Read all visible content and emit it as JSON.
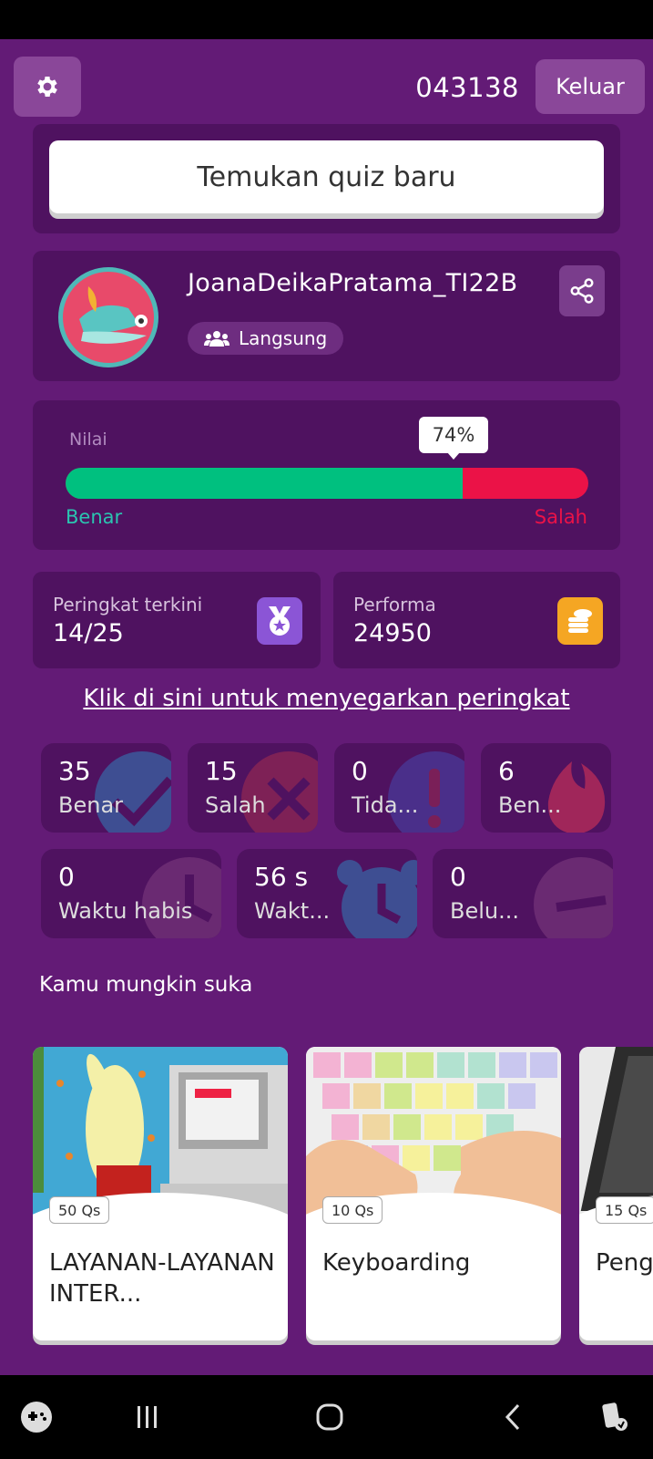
{
  "header": {
    "room_code": "043138",
    "exit_label": "Keluar"
  },
  "find_quiz": {
    "label": "Temukan quiz baru"
  },
  "profile": {
    "username": "JoanaDeikaPratama_TI22B",
    "mode": "Langsung"
  },
  "score": {
    "label": "Nilai",
    "percent_text": "74%",
    "percent": 0.76,
    "correct_label": "Benar",
    "wrong_label": "Salah"
  },
  "rank": {
    "label": "Peringkat terkini",
    "value": "14/25"
  },
  "performance": {
    "label": "Performa",
    "value": "24950"
  },
  "refresh_link": "Klik di sini untuk menyegarkan peringkat",
  "stats": [
    {
      "value": "35",
      "label": "Benar"
    },
    {
      "value": "15",
      "label": "Salah"
    },
    {
      "value": "0",
      "label": "Tida..."
    },
    {
      "value": "6",
      "label": "Ben..."
    },
    {
      "value": "0",
      "label": "Waktu habis"
    },
    {
      "value": "56 s",
      "label": "Wakt..."
    },
    {
      "value": "0",
      "label": "Belu..."
    }
  ],
  "recommendations": {
    "title": "Kamu mungkin suka",
    "items": [
      {
        "qs": "50 Qs",
        "title": "LAYANAN-LAYANAN INTER..."
      },
      {
        "qs": "10 Qs",
        "title": "Keyboarding"
      },
      {
        "qs": "15 Qs",
        "title": "Peng Word"
      }
    ]
  },
  "colors": {
    "background": "#631b76",
    "panel": "#4f1260",
    "correct": "#00c07f",
    "wrong": "#eb1247"
  }
}
